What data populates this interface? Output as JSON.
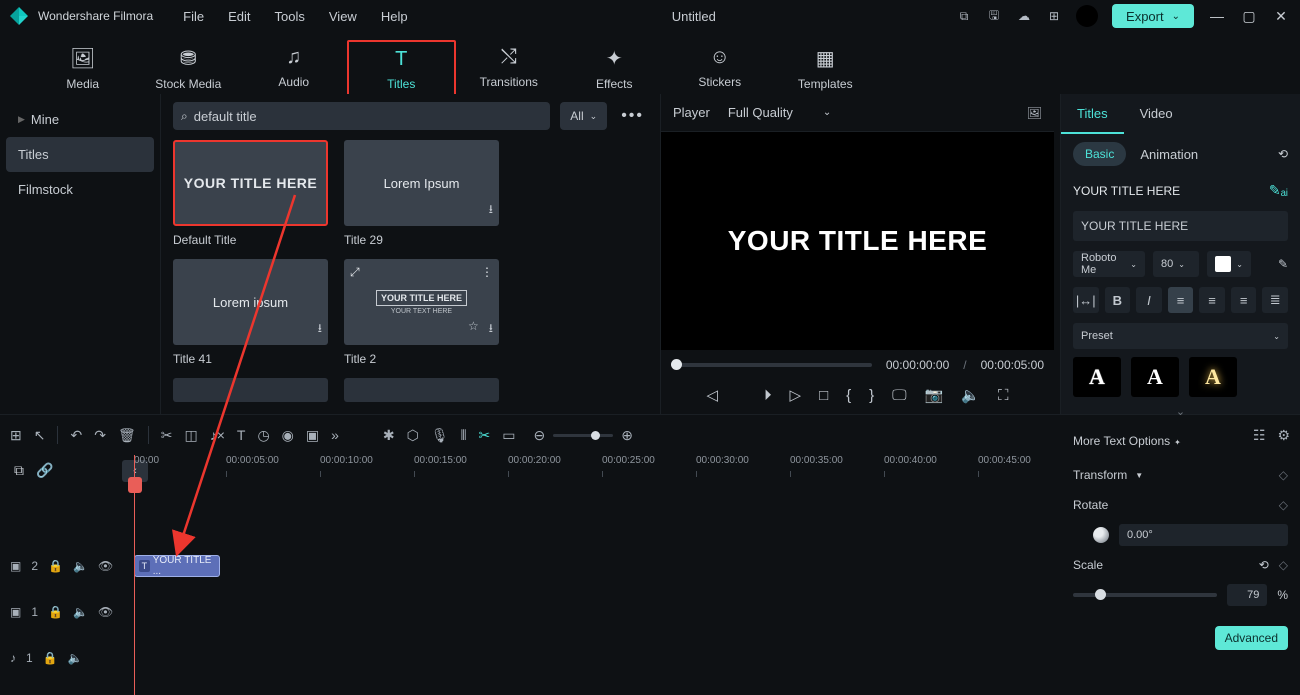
{
  "app": {
    "name": "Wondershare Filmora"
  },
  "menu": [
    "File",
    "Edit",
    "Tools",
    "View",
    "Help"
  ],
  "document": {
    "title": "Untitled"
  },
  "export_label": "Export",
  "ribbon_tabs": [
    {
      "label": "Media"
    },
    {
      "label": "Stock Media"
    },
    {
      "label": "Audio"
    },
    {
      "label": "Titles",
      "active": true
    },
    {
      "label": "Transitions"
    },
    {
      "label": "Effects"
    },
    {
      "label": "Stickers"
    },
    {
      "label": "Templates"
    }
  ],
  "sidebar": {
    "items": [
      {
        "label": "Mine"
      },
      {
        "label": "Titles",
        "active": true
      },
      {
        "label": "Filmstock"
      }
    ]
  },
  "search": {
    "value": "default title"
  },
  "filter": {
    "label": "All"
  },
  "cards": [
    {
      "label": "Default Title",
      "preview_text": "YOUR TITLE HERE",
      "highlighted": true
    },
    {
      "label": "Title 29",
      "preview_text": "Lorem Ipsum"
    },
    {
      "label": "Title 41",
      "preview_text": "Lorem ipsum"
    },
    {
      "label": "Title 2",
      "preview_text": "YOUR TITLE HERE",
      "subtext": "YOUR TEXT HERE"
    }
  ],
  "player": {
    "label": "Player",
    "quality": "Full Quality",
    "preview_text": "YOUR TITLE HERE",
    "current_time": "00:00:00:00",
    "duration": "00:00:05:00"
  },
  "inspector": {
    "tabs": [
      "Titles",
      "Video"
    ],
    "subtabs": {
      "basic": "Basic",
      "animation": "Animation"
    },
    "title_text": "YOUR TITLE HERE",
    "textarea_value": "YOUR TITLE HERE",
    "font_name": "Roboto Me",
    "font_size": "80",
    "preset_label": "Preset",
    "preset_glyph": "A",
    "more_options": "More Text Options",
    "transform": {
      "label": "Transform",
      "rotate_label": "Rotate",
      "rotate_value": "0.00°",
      "scale_label": "Scale",
      "scale_value": "79",
      "scale_unit": "%"
    },
    "advanced_label": "Advanced"
  },
  "timeline": {
    "ruler": [
      "00:00",
      "00:00:05:00",
      "00:00:10:00",
      "00:00:15:00",
      "00:00:20:00",
      "00:00:25:00",
      "00:00:30:00",
      "00:00:35:00",
      "00:00:40:00",
      "00:00:45:00"
    ],
    "clip_label": "YOUR TITLE ...",
    "tracks": [
      {
        "name": "T2",
        "n": "2"
      },
      {
        "name": "V1",
        "n": "1"
      },
      {
        "name": "A1",
        "n": "1"
      }
    ]
  }
}
